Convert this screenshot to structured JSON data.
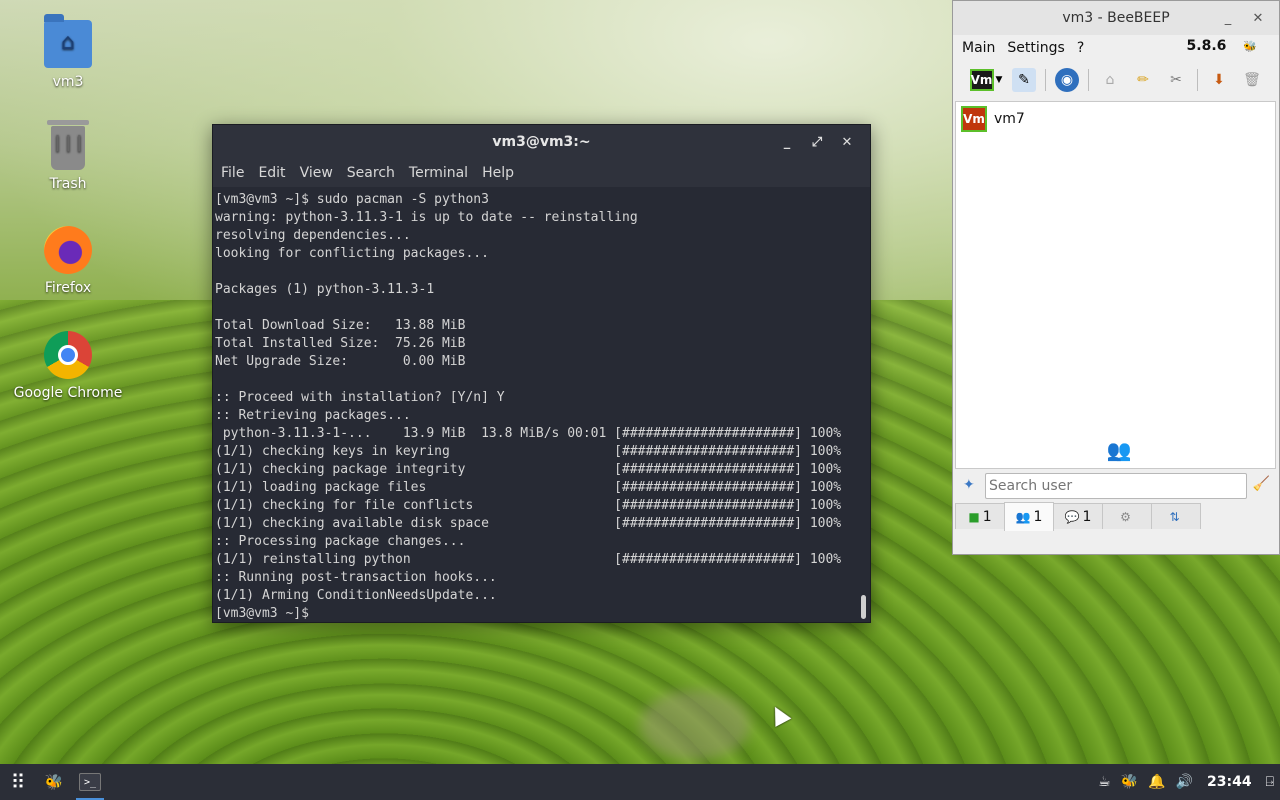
{
  "desktop": {
    "icons": [
      {
        "label": "vm3",
        "icon": "home-folder-icon"
      },
      {
        "label": "Trash",
        "icon": "trash-icon"
      },
      {
        "label": "Firefox",
        "icon": "firefox-icon"
      },
      {
        "label": "Google Chrome",
        "icon": "chrome-icon"
      }
    ]
  },
  "terminal": {
    "title": "vm3@vm3:~",
    "menu": [
      "File",
      "Edit",
      "View",
      "Search",
      "Terminal",
      "Help"
    ],
    "lines": [
      "[vm3@vm3 ~]$ sudo pacman -S python3",
      "warning: python-3.11.3-1 is up to date -- reinstalling",
      "resolving dependencies...",
      "looking for conflicting packages...",
      "",
      "Packages (1) python-3.11.3-1",
      "",
      "Total Download Size:   13.88 MiB",
      "Total Installed Size:  75.26 MiB",
      "Net Upgrade Size:       0.00 MiB",
      "",
      ":: Proceed with installation? [Y/n] Y",
      ":: Retrieving packages...",
      " python-3.11.3-1-...    13.9 MiB  13.8 MiB/s 00:01 [######################] 100%",
      "(1/1) checking keys in keyring                     [######################] 100%",
      "(1/1) checking package integrity                   [######################] 100%",
      "(1/1) loading package files                        [######################] 100%",
      "(1/1) checking for file conflicts                  [######################] 100%",
      "(1/1) checking available disk space                [######################] 100%",
      ":: Processing package changes...",
      "(1/1) reinstalling python                          [######################] 100%",
      ":: Running post-transaction hooks...",
      "(1/1) Arming ConditionNeedsUpdate...",
      "[vm3@vm3 ~]$ "
    ]
  },
  "beebeep": {
    "title": "vm3 - BeeBEEP",
    "menu": [
      "Main",
      "Settings",
      "?"
    ],
    "version": "5.8.6",
    "users": [
      {
        "badge": "Vm",
        "name": "vm7"
      }
    ],
    "search_placeholder": "Search user",
    "tabs": [
      {
        "icon": "chat-screen-icon",
        "count": "1"
      },
      {
        "icon": "users-icon",
        "count": "1"
      },
      {
        "icon": "chat-bubbles-icon",
        "count": "1"
      },
      {
        "icon": "groups-icon",
        "count": ""
      },
      {
        "icon": "share-icon",
        "count": ""
      }
    ],
    "toolbar_user_badge": "Vm"
  },
  "taskbar": {
    "clock": "23:44"
  }
}
